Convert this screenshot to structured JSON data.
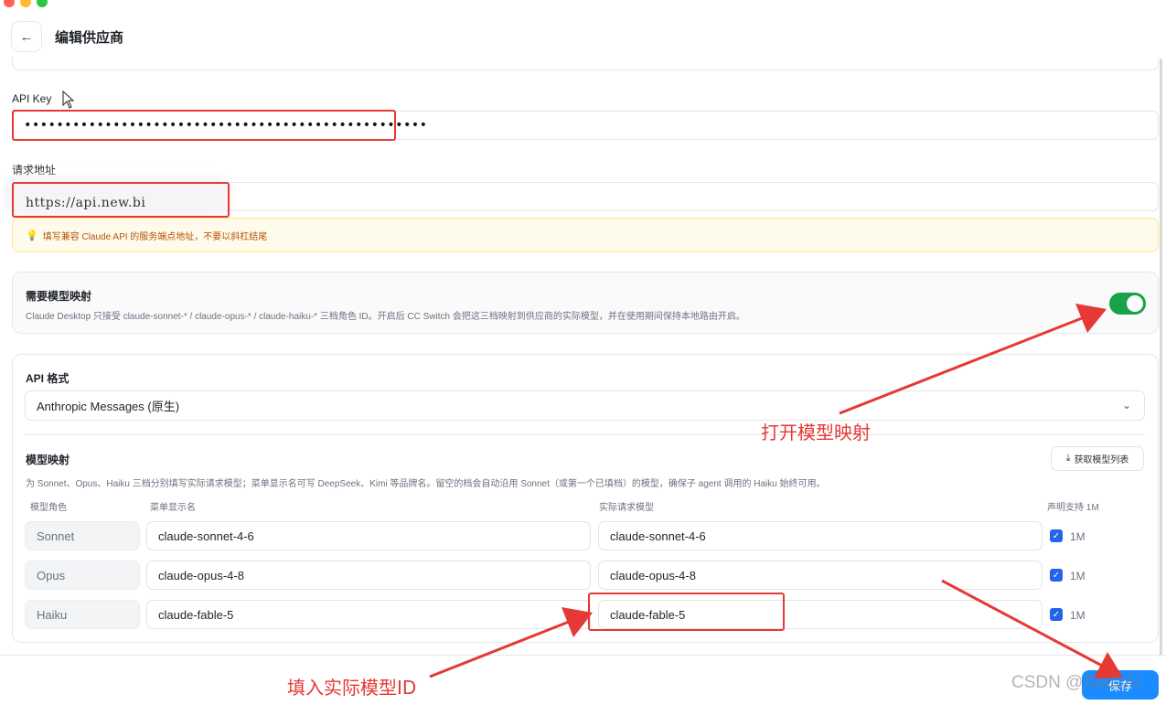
{
  "header": {
    "title": "编辑供应商",
    "back_icon": "arrow-left-icon"
  },
  "api_key": {
    "label": "API Key",
    "value": "••••••••••••••••••••••••••••••••••••••••••••••••••"
  },
  "request_url": {
    "label": "请求地址",
    "value": "https://api.new.bi",
    "hint": "填写兼容 Claude API 的服务端点地址，不要以斜杠结尾",
    "hint_icon": "lightbulb-icon"
  },
  "model_mapping_toggle": {
    "title": "需要模型映射",
    "description": "Claude Desktop 只接受 claude-sonnet-* / claude-opus-* / claude-haiku-* 三档角色 ID。开启后 CC Switch 会把这三档映射到供应商的实际模型，并在使用期间保持本地路由开启。",
    "enabled": true
  },
  "api_format": {
    "label": "API 格式",
    "selected": "Anthropic Messages (原生)"
  },
  "model_map": {
    "title": "模型映射",
    "fetch_button": "获取模型列表",
    "description": "为 Sonnet、Opus、Haiku 三档分别填写实际请求模型；菜单显示名可写 DeepSeek、Kimi 等品牌名。留空的档会自动沿用 Sonnet（或第一个已填档）的模型，确保子 agent 调用的 Haiku 始终可用。",
    "columns": [
      "模型角色",
      "菜单显示名",
      "实际请求模型",
      "声明支持 1M"
    ],
    "rows": [
      {
        "role": "Sonnet",
        "display": "claude-sonnet-4-6",
        "actual": "claude-sonnet-4-6",
        "one_m": "1M",
        "checked": true
      },
      {
        "role": "Opus",
        "display": "claude-opus-4-8",
        "actual": "claude-opus-4-8",
        "one_m": "1M",
        "checked": true
      },
      {
        "role": "Haiku",
        "display": "claude-fable-5",
        "actual": "claude-fable-5",
        "one_m": "1M",
        "checked": true
      }
    ]
  },
  "footer": {
    "save_label": "保存"
  },
  "annotations": {
    "toggle_note": "打开模型映射",
    "fill_note": "填入实际模型ID",
    "color": "#e53935"
  },
  "watermark": "CSDN @Sub2AI",
  "colors": {
    "accent": "#1a8cff",
    "toggle_on": "#16a34a",
    "annotation_red": "#e53935",
    "hint_bg": "#fffbeb"
  }
}
